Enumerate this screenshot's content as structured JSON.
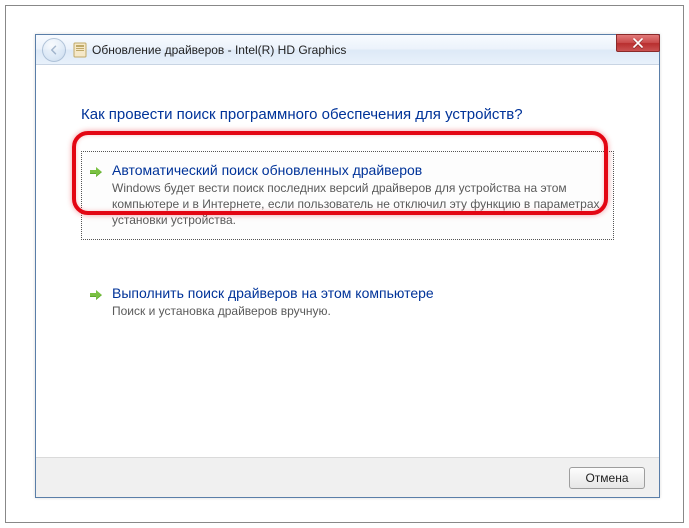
{
  "window": {
    "title": "Обновление драйверов - Intel(R) HD Graphics"
  },
  "heading": "Как провести поиск программного обеспечения для устройств?",
  "options": {
    "auto": {
      "title": "Автоматический поиск обновленных драйверов",
      "desc": "Windows будет вести поиск последних версий драйверов для устройства на этом компьютере и в Интернете, если пользователь не отключил эту функцию в параметрах установки устройства."
    },
    "manual": {
      "title": "Выполнить поиск драйверов на этом компьютере",
      "desc": "Поиск и установка драйверов вручную."
    }
  },
  "footer": {
    "cancel": "Отмена"
  }
}
